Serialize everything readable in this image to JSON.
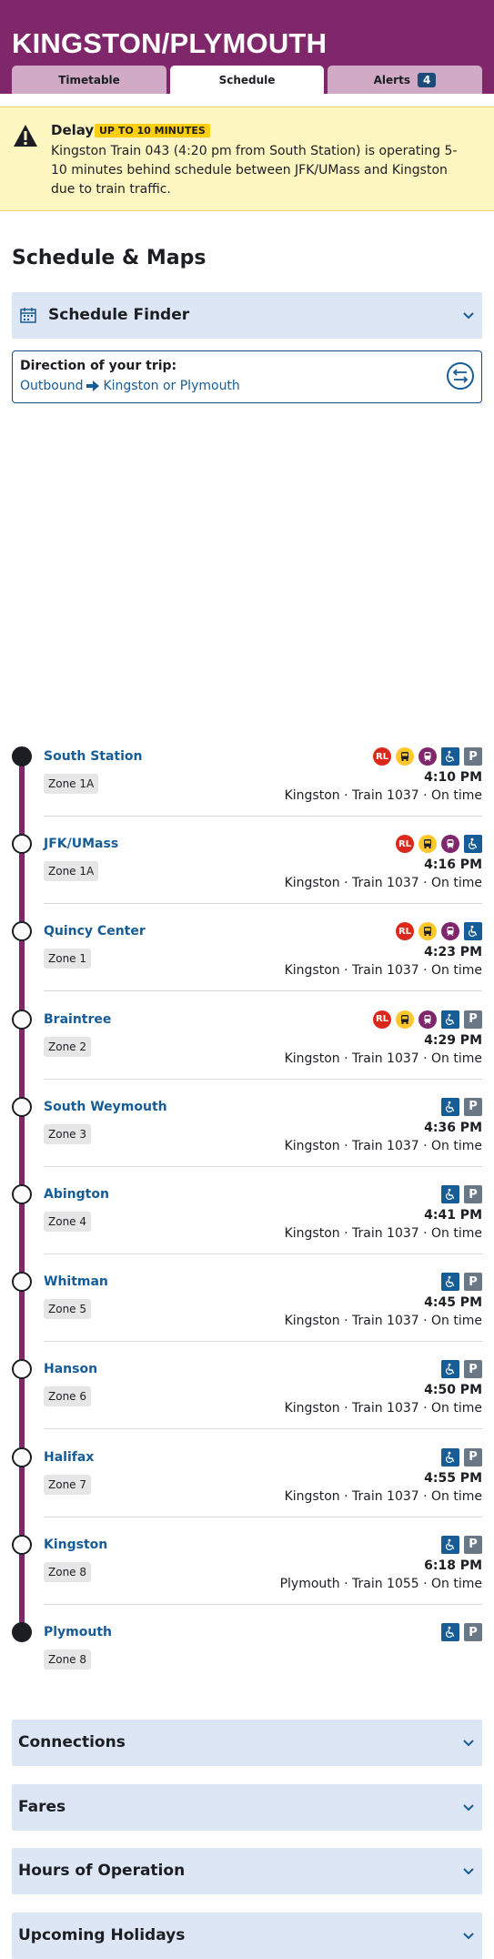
{
  "header": {
    "route_title": "KINGSTON/PLYMOUTH",
    "tabs": [
      {
        "label": "Timetable"
      },
      {
        "label": "Schedule"
      },
      {
        "label": "Alerts",
        "badge": "4"
      }
    ]
  },
  "alert": {
    "title": "Delay",
    "pill": "UP TO 10 MINUTES",
    "body": "Kingston Train 043 (4:20 pm from South Station) is operating 5-10 minutes behind schedule between JFK/UMass and Kingston due to train traffic."
  },
  "section_title": "Schedule & Maps",
  "schedule_finder": {
    "label": "Schedule Finder"
  },
  "direction": {
    "label": "Direction of your trip:",
    "direction_name": "Outbound",
    "destination": "Kingston or Plymouth"
  },
  "stops": [
    {
      "name": "South Station",
      "zone": "Zone 1A",
      "time": "4:10 PM",
      "trip": "Kingston · Train 1037 · On time",
      "icons": [
        "RL",
        "bus",
        "cr",
        "acc",
        "park"
      ],
      "terminal": true
    },
    {
      "name": "JFK/UMass",
      "zone": "Zone 1A",
      "time": "4:16 PM",
      "trip": "Kingston · Train 1037 · On time",
      "icons": [
        "RL",
        "bus",
        "cr",
        "acc"
      ]
    },
    {
      "name": "Quincy Center",
      "zone": "Zone 1",
      "time": "4:23 PM",
      "trip": "Kingston · Train 1037 · On time",
      "icons": [
        "RL",
        "bus",
        "cr",
        "acc"
      ]
    },
    {
      "name": "Braintree",
      "zone": "Zone 2",
      "time": "4:29 PM",
      "trip": "Kingston · Train 1037 · On time",
      "icons": [
        "RL",
        "bus",
        "cr",
        "acc",
        "park"
      ]
    },
    {
      "name": "South Weymouth",
      "zone": "Zone 3",
      "time": "4:36 PM",
      "trip": "Kingston · Train 1037 · On time",
      "icons": [
        "acc",
        "park"
      ]
    },
    {
      "name": "Abington",
      "zone": "Zone 4",
      "time": "4:41 PM",
      "trip": "Kingston · Train 1037 · On time",
      "icons": [
        "acc",
        "park"
      ]
    },
    {
      "name": "Whitman",
      "zone": "Zone 5",
      "time": "4:45 PM",
      "trip": "Kingston · Train 1037 · On time",
      "icons": [
        "acc",
        "park"
      ]
    },
    {
      "name": "Hanson",
      "zone": "Zone 6",
      "time": "4:50 PM",
      "trip": "Kingston · Train 1037 · On time",
      "icons": [
        "acc",
        "park"
      ]
    },
    {
      "name": "Halifax",
      "zone": "Zone 7",
      "time": "4:55 PM",
      "trip": "Kingston · Train 1037 · On time",
      "icons": [
        "acc",
        "park"
      ]
    },
    {
      "name": "Kingston",
      "zone": "Zone 8",
      "time": "6:18 PM",
      "trip": "Plymouth · Train 1055 · On time",
      "icons": [
        "acc",
        "park"
      ]
    },
    {
      "name": "Plymouth",
      "zone": "Zone 8",
      "time": "",
      "trip": "",
      "icons": [
        "acc",
        "park"
      ],
      "terminal": true
    }
  ],
  "accordions": [
    {
      "label": "Connections"
    },
    {
      "label": "Fares"
    },
    {
      "label": "Hours of Operation"
    },
    {
      "label": "Upcoming Holidays"
    }
  ],
  "icon_labels": {
    "RL": "RL",
    "park": "P"
  },
  "colors": {
    "route": "#80276c",
    "link": "#165c96",
    "alert_bg": "#fdf6c0",
    "pill": "#ffce0c"
  }
}
